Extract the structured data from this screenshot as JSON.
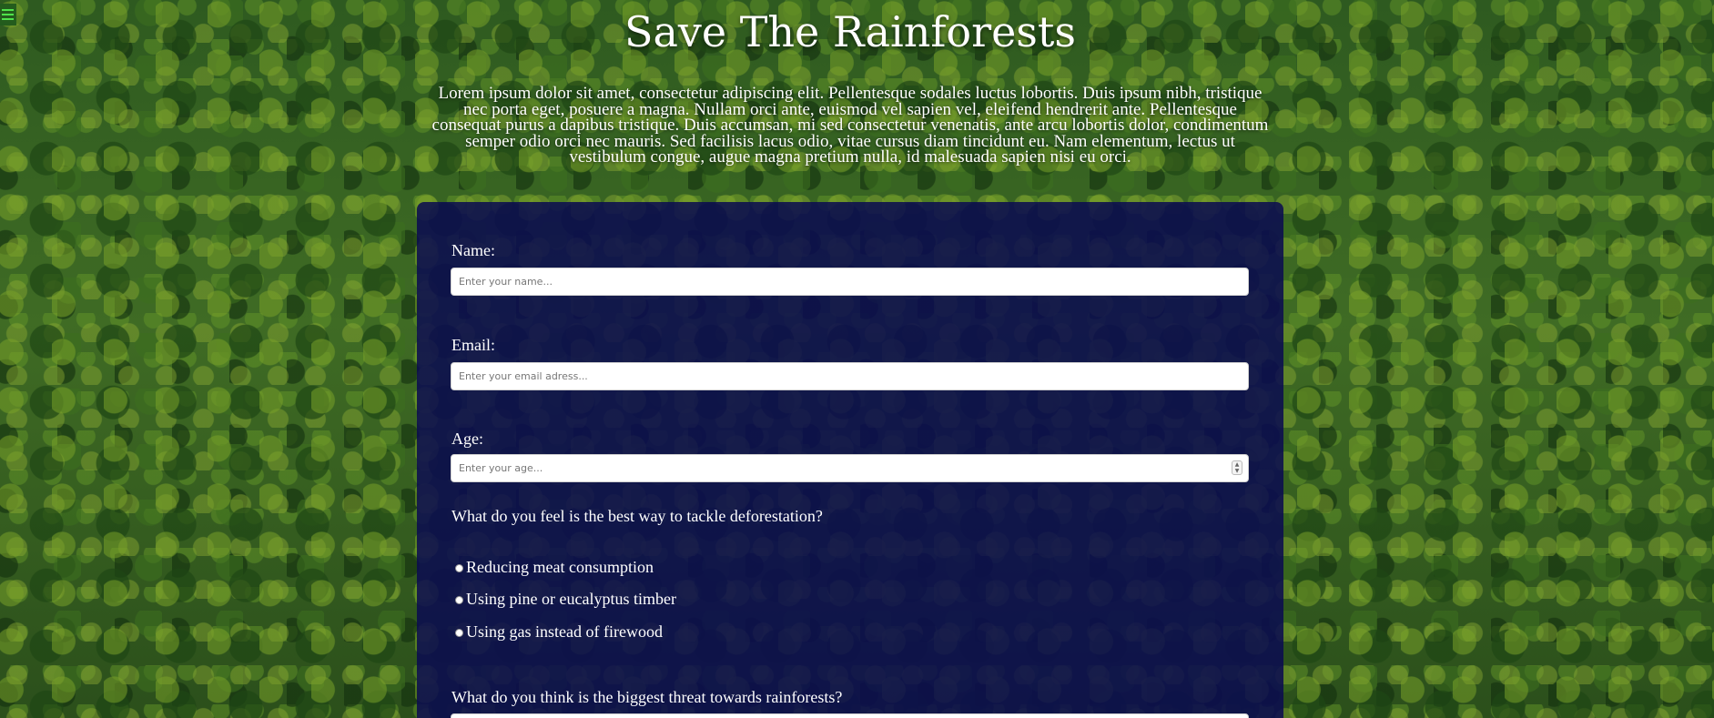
{
  "page": {
    "title": "Save The Rainforests",
    "intro": "Lorem ipsum dolor sit amet, consectetur adipiscing elit. Pellentesque sodales luctus lobortis. Duis ipsum nibh, tristique nec porta eget, posuere a magna. Nullam orci ante, euismod vel sapien vel, eleifend hendrerit ante. Pellentesque consequat purus a dapibus tristique. Duis accumsan, mi sed consectetur venenatis, ante arcu lobortis dolor, condimentum semper odio orci nec mauris. Sed facilisis lacus odio, vitae cursus diam tincidunt eu. Nam elementum, lectus ut vestibulum congue, augue magna pretium nulla, id malesuada sapien nisi eu orci."
  },
  "form": {
    "name": {
      "label": "Name:",
      "placeholder": "Enter your name...",
      "value": ""
    },
    "email": {
      "label": "Email:",
      "placeholder": "Enter your email adress...",
      "value": ""
    },
    "age": {
      "label": "Age:",
      "placeholder": "Enter your age...",
      "value": ""
    },
    "deforestation_question": "What do you feel is the best way to tackle deforestation?",
    "deforestation_options": [
      "Reducing meat consumption",
      "Using pine or eucalyptus timber",
      "Using gas instead of firewood"
    ],
    "threat_question": "What do you think is the biggest threat towards rainforests?"
  },
  "icons": {
    "corner": "menu-icon"
  },
  "colors": {
    "form_background": "#0a0a50",
    "accent_green": "#4fe34a"
  }
}
